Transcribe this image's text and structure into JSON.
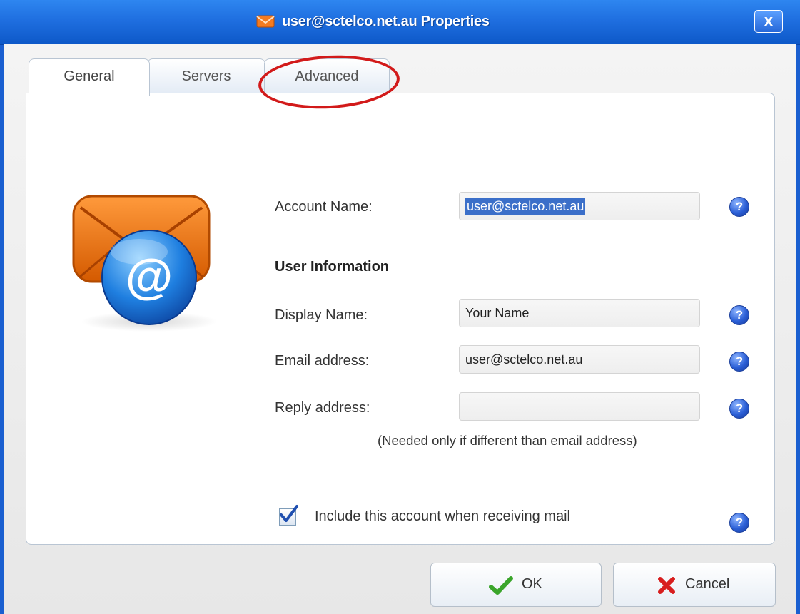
{
  "window": {
    "title": "user@sctelco.net.au Properties",
    "close_glyph": "x",
    "accent_color": "#1f6fe0"
  },
  "tabs": [
    {
      "label": "General",
      "active": true
    },
    {
      "label": "Servers",
      "active": false
    },
    {
      "label": "Advanced",
      "active": false,
      "annotated": true
    }
  ],
  "annotation": {
    "shape": "hand-drawn ellipse",
    "color": "#d21a1a",
    "target": "Advanced"
  },
  "account": {
    "label": "Account Name:",
    "value": "user@sctelco.net.au",
    "selected": true
  },
  "user_info": {
    "heading": "User Information",
    "display_name": {
      "label": "Display Name:",
      "value": "Your Name"
    },
    "email": {
      "label": "Email address:",
      "value": "user@sctelco.net.au"
    },
    "reply": {
      "label": "Reply address:",
      "value": ""
    },
    "reply_note": "(Needed only if different than email address)"
  },
  "receive": {
    "label": "Include this account when receiving mail",
    "checked": true
  },
  "help_glyph": "?",
  "buttons": {
    "ok": {
      "label": "OK",
      "icon": "green-check-icon"
    },
    "cancel": {
      "label": "Cancel",
      "icon": "red-x-icon"
    }
  }
}
